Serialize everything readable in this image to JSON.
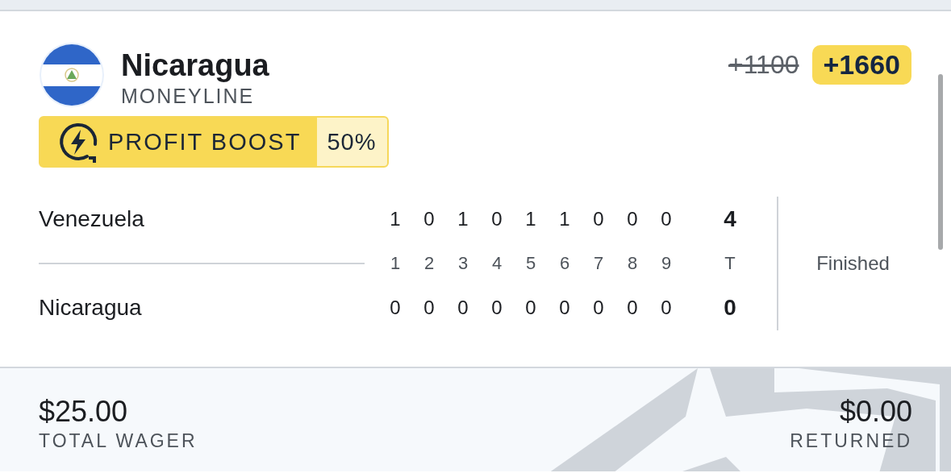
{
  "selection": {
    "team": "Nicaragua",
    "market": "MONEYLINE",
    "original_odds": "+1100",
    "boosted_odds": "+1660",
    "boost": {
      "label": "PROFIT BOOST",
      "percent": "50%"
    }
  },
  "scoreboard": {
    "innings": [
      "1",
      "2",
      "3",
      "4",
      "5",
      "6",
      "7",
      "8",
      "9"
    ],
    "total_label": "T",
    "status": "Finished",
    "teams": [
      {
        "name": "Venezuela",
        "innings": [
          "1",
          "0",
          "1",
          "0",
          "1",
          "1",
          "0",
          "0",
          "0"
        ],
        "total": "4"
      },
      {
        "name": "Nicaragua",
        "innings": [
          "0",
          "0",
          "0",
          "0",
          "0",
          "0",
          "0",
          "0",
          "0"
        ],
        "total": "0"
      }
    ]
  },
  "footer": {
    "wager": {
      "amount": "$25.00",
      "label": "TOTAL WAGER"
    },
    "returned": {
      "amount": "$0.00",
      "label": "RETURNED"
    }
  }
}
